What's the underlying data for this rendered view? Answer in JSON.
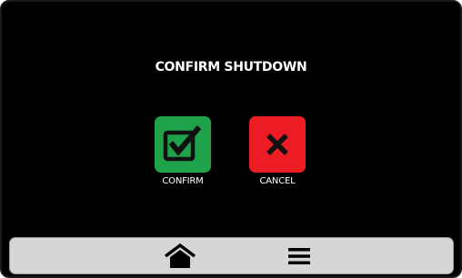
{
  "dialog": {
    "title": "CONFIRM SHUTDOWN"
  },
  "actions": {
    "confirm": {
      "label": "CONFIRM",
      "icon": "checkbox-check-icon",
      "color": "#1fa34a"
    },
    "cancel": {
      "label": "CANCEL",
      "icon": "x-icon",
      "color": "#ec1c24"
    }
  },
  "nav": {
    "home_icon": "home-icon",
    "menu_icon": "hamburger-menu-icon"
  },
  "colors": {
    "screen_background": "#000000",
    "nav_bar": "#d6d6d6"
  }
}
